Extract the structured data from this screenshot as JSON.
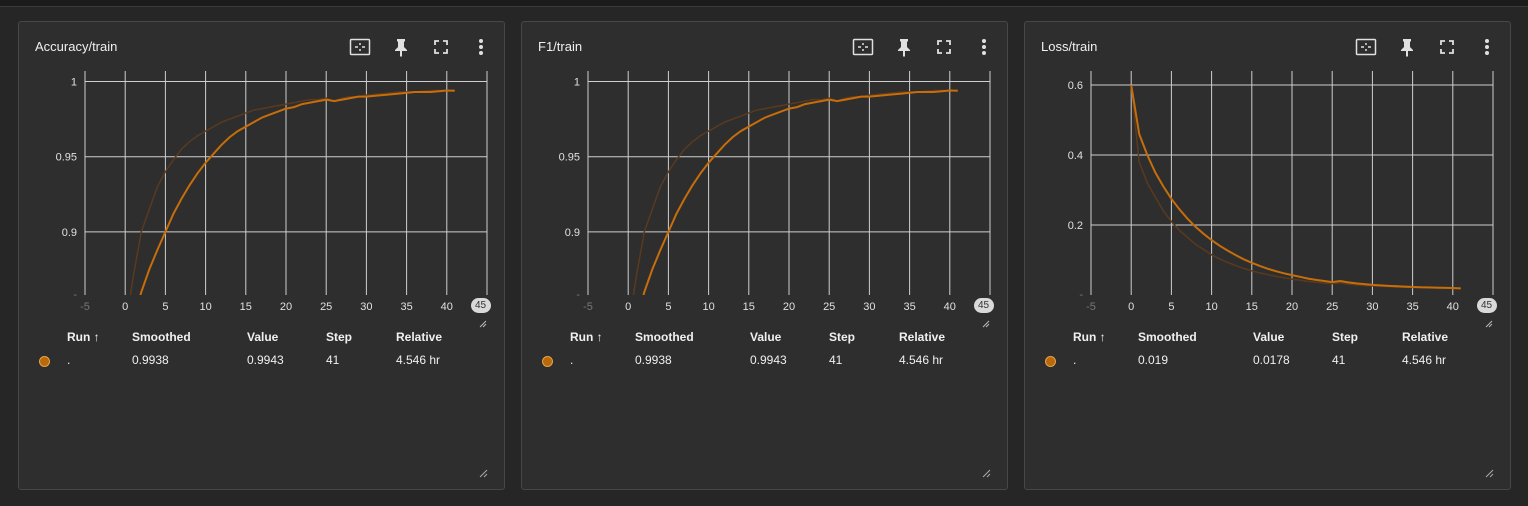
{
  "colors": {
    "smoothed": "#c76d09",
    "raw": "#5a3a1f",
    "grid": "#cfcfcf",
    "card_bg": "#2e2e2e"
  },
  "icons": [
    "fit-domain-icon",
    "pin-icon",
    "fullscreen-icon",
    "more-vert-icon"
  ],
  "table_headers": {
    "run": "Run ↑",
    "smoothed": "Smoothed",
    "value": "Value",
    "step": "Step",
    "relative": "Relative"
  },
  "cards": [
    {
      "title": "Accuracy/train",
      "x_badge": "45",
      "x_dim_tick": "-5",
      "row": {
        "run": ".",
        "smoothed": "0.9938",
        "value": "0.9943",
        "step": "41",
        "relative": "4.546 hr"
      }
    },
    {
      "title": "F1/train",
      "x_badge": "45",
      "x_dim_tick": "-5",
      "row": {
        "run": ".",
        "smoothed": "0.9938",
        "value": "0.9943",
        "step": "41",
        "relative": "4.546 hr"
      }
    },
    {
      "title": "Loss/train",
      "x_badge": "45",
      "x_dim_tick": "-5",
      "row": {
        "run": ".",
        "smoothed": "0.019",
        "value": "0.0178",
        "step": "41",
        "relative": "4.546 hr"
      }
    }
  ],
  "chart_data": [
    {
      "type": "line",
      "title": "Accuracy/train",
      "xlim": [
        -5,
        45
      ],
      "ylim": [
        0.858,
        1.007
      ],
      "xticks": [
        0,
        5,
        10,
        15,
        20,
        25,
        30,
        35,
        40
      ],
      "yticks": [
        0.9,
        0.95,
        1
      ],
      "ytick_labels": [
        "0.9",
        "0.95",
        "1"
      ],
      "series": [
        {
          "role": "raw",
          "x": [
            0,
            1,
            2,
            3,
            4,
            5,
            6,
            7,
            8,
            9,
            10,
            11,
            12,
            13,
            14,
            15,
            16,
            17,
            18,
            19,
            20,
            21,
            22,
            23,
            24,
            25,
            26,
            27,
            28,
            29,
            30,
            32,
            34,
            36,
            38,
            40,
            41
          ],
          "y": [
            0.835,
            0.87,
            0.9,
            0.915,
            0.93,
            0.94,
            0.948,
            0.955,
            0.96,
            0.964,
            0.967,
            0.97,
            0.973,
            0.975,
            0.977,
            0.979,
            0.981,
            0.982,
            0.983,
            0.984,
            0.985,
            0.986,
            0.987,
            0.988,
            0.988,
            0.989,
            0.987,
            0.989,
            0.99,
            0.99,
            0.991,
            0.992,
            0.993,
            0.993,
            0.994,
            0.994,
            0.9943
          ]
        },
        {
          "role": "smoothed",
          "x": [
            0,
            1,
            2,
            3,
            4,
            5,
            6,
            7,
            8,
            9,
            10,
            11,
            12,
            13,
            14,
            15,
            16,
            17,
            18,
            19,
            20,
            21,
            22,
            23,
            24,
            25,
            26,
            27,
            28,
            29,
            30,
            32,
            34,
            36,
            38,
            40,
            41
          ],
          "y": [
            0.82,
            0.84,
            0.86,
            0.875,
            0.888,
            0.9,
            0.912,
            0.922,
            0.931,
            0.939,
            0.946,
            0.952,
            0.958,
            0.963,
            0.967,
            0.97,
            0.973,
            0.976,
            0.978,
            0.98,
            0.982,
            0.983,
            0.985,
            0.986,
            0.987,
            0.988,
            0.987,
            0.988,
            0.989,
            0.99,
            0.99,
            0.991,
            0.992,
            0.993,
            0.993,
            0.994,
            0.9938
          ]
        }
      ]
    },
    {
      "type": "line",
      "title": "F1/train",
      "xlim": [
        -5,
        45
      ],
      "ylim": [
        0.858,
        1.007
      ],
      "xticks": [
        0,
        5,
        10,
        15,
        20,
        25,
        30,
        35,
        40
      ],
      "yticks": [
        0.9,
        0.95,
        1
      ],
      "ytick_labels": [
        "0.9",
        "0.95",
        "1"
      ],
      "series": [
        {
          "role": "raw",
          "x": [
            0,
            1,
            2,
            3,
            4,
            5,
            6,
            7,
            8,
            9,
            10,
            11,
            12,
            13,
            14,
            15,
            16,
            17,
            18,
            19,
            20,
            21,
            22,
            23,
            24,
            25,
            26,
            27,
            28,
            29,
            30,
            32,
            34,
            36,
            38,
            40,
            41
          ],
          "y": [
            0.835,
            0.87,
            0.9,
            0.915,
            0.93,
            0.94,
            0.948,
            0.955,
            0.96,
            0.964,
            0.967,
            0.97,
            0.973,
            0.975,
            0.977,
            0.979,
            0.981,
            0.982,
            0.983,
            0.984,
            0.985,
            0.986,
            0.987,
            0.988,
            0.988,
            0.989,
            0.987,
            0.989,
            0.99,
            0.99,
            0.991,
            0.992,
            0.993,
            0.993,
            0.994,
            0.994,
            0.9943
          ]
        },
        {
          "role": "smoothed",
          "x": [
            0,
            1,
            2,
            3,
            4,
            5,
            6,
            7,
            8,
            9,
            10,
            11,
            12,
            13,
            14,
            15,
            16,
            17,
            18,
            19,
            20,
            21,
            22,
            23,
            24,
            25,
            26,
            27,
            28,
            29,
            30,
            32,
            34,
            36,
            38,
            40,
            41
          ],
          "y": [
            0.82,
            0.84,
            0.86,
            0.875,
            0.888,
            0.9,
            0.912,
            0.922,
            0.931,
            0.939,
            0.946,
            0.952,
            0.958,
            0.963,
            0.967,
            0.97,
            0.973,
            0.976,
            0.978,
            0.98,
            0.982,
            0.983,
            0.985,
            0.986,
            0.987,
            0.988,
            0.987,
            0.988,
            0.989,
            0.99,
            0.99,
            0.991,
            0.992,
            0.993,
            0.993,
            0.994,
            0.9938
          ]
        }
      ]
    },
    {
      "type": "line",
      "title": "Loss/train",
      "xlim": [
        -5,
        45
      ],
      "ylim": [
        0,
        0.64
      ],
      "xticks": [
        0,
        5,
        10,
        15,
        20,
        25,
        30,
        35,
        40
      ],
      "yticks": [
        0.2,
        0.4,
        0.6
      ],
      "ytick_labels": [
        "0.2",
        "0.4",
        "0.6"
      ],
      "series": [
        {
          "role": "raw",
          "x": [
            0,
            1,
            2,
            3,
            4,
            5,
            6,
            7,
            8,
            9,
            10,
            11,
            12,
            13,
            14,
            15,
            16,
            17,
            18,
            19,
            20,
            21,
            22,
            23,
            24,
            25,
            26,
            27,
            28,
            29,
            30,
            32,
            34,
            36,
            38,
            40,
            41
          ],
          "y": [
            0.6,
            0.38,
            0.32,
            0.28,
            0.24,
            0.21,
            0.185,
            0.165,
            0.145,
            0.13,
            0.115,
            0.103,
            0.093,
            0.084,
            0.076,
            0.069,
            0.063,
            0.058,
            0.053,
            0.049,
            0.045,
            0.042,
            0.039,
            0.037,
            0.034,
            0.032,
            0.035,
            0.031,
            0.029,
            0.027,
            0.026,
            0.024,
            0.022,
            0.021,
            0.02,
            0.019,
            0.0178
          ]
        },
        {
          "role": "smoothed",
          "x": [
            0,
            1,
            2,
            3,
            4,
            5,
            6,
            7,
            8,
            9,
            10,
            11,
            12,
            13,
            14,
            15,
            16,
            17,
            18,
            19,
            20,
            21,
            22,
            23,
            24,
            25,
            26,
            27,
            28,
            29,
            30,
            32,
            34,
            36,
            38,
            40,
            41
          ],
          "y": [
            0.6,
            0.46,
            0.4,
            0.35,
            0.31,
            0.275,
            0.245,
            0.218,
            0.195,
            0.175,
            0.157,
            0.141,
            0.127,
            0.114,
            0.102,
            0.092,
            0.083,
            0.075,
            0.068,
            0.062,
            0.057,
            0.052,
            0.047,
            0.043,
            0.04,
            0.037,
            0.04,
            0.036,
            0.033,
            0.031,
            0.029,
            0.026,
            0.024,
            0.022,
            0.021,
            0.02,
            0.019
          ]
        }
      ]
    }
  ]
}
